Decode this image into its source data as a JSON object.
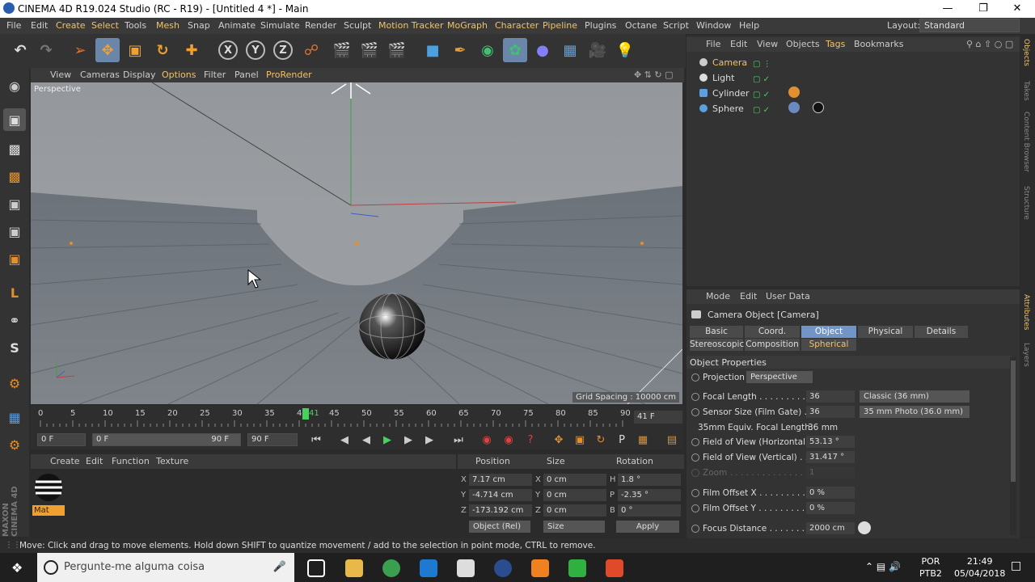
{
  "window": {
    "title": "CINEMA 4D R19.024 Studio (RC - R19) - [Untitled 4 *] - Main"
  },
  "menu": {
    "items": [
      "File",
      "Edit",
      "Create",
      "Select",
      "Tools",
      "Mesh",
      "Snap",
      "Animate",
      "Simulate",
      "Render",
      "Sculpt",
      "Motion Tracker",
      "MoGraph",
      "Character",
      "Pipeline",
      "Plugins",
      "Octane",
      "Script",
      "Window",
      "Help"
    ],
    "layout_label": "Layout:",
    "layout_value": "Standard"
  },
  "toolbar": {
    "axis_x": "X",
    "axis_y": "Y",
    "axis_z": "Z"
  },
  "viewport": {
    "menu": [
      "View",
      "Cameras",
      "Display",
      "Options",
      "Filter",
      "Panel",
      "ProRender"
    ],
    "label": "Perspective",
    "grid_spacing": "Grid Spacing : 10000 cm"
  },
  "timeline": {
    "ticks": [
      "0",
      "5",
      "10",
      "15",
      "20",
      "25",
      "30",
      "35",
      "40",
      "45",
      "50",
      "55",
      "60",
      "65",
      "70",
      "75",
      "80",
      "85",
      "90"
    ],
    "current_frame_marker": "41",
    "frame_readout": "41 F"
  },
  "transport": {
    "start": "0 F",
    "slider_start": "0 F",
    "slider_end": "90 F",
    "end": "90 F"
  },
  "material_manager": {
    "menu": [
      "Create",
      "Edit",
      "Function",
      "Texture"
    ],
    "material_name": "Mat"
  },
  "coord_manager": {
    "headers": [
      "Position",
      "Size",
      "Rotation"
    ],
    "pos": {
      "x": "7.17 cm",
      "y": "-4.714 cm",
      "z": "-173.192 cm"
    },
    "size": {
      "x": "0 cm",
      "y": "0 cm",
      "z": "0 cm"
    },
    "rot": {
      "h": "1.8 °",
      "p": "-2.35 °",
      "b": "0 °"
    },
    "axis_labels": {
      "x": "X",
      "y": "Y",
      "z": "Z",
      "h": "H",
      "p": "P",
      "b": "B"
    },
    "mode": "Object (Rel)",
    "size_mode": "Size",
    "apply": "Apply"
  },
  "object_manager": {
    "menu": [
      "File",
      "Edit",
      "View",
      "Objects",
      "Tags",
      "Bookmarks"
    ],
    "objects": [
      {
        "name": "Camera",
        "color": "#f0c36a"
      },
      {
        "name": "Light",
        "color": "#dddddd"
      },
      {
        "name": "Cylinder",
        "color": "#dddddd"
      },
      {
        "name": "Sphere",
        "color": "#dddddd"
      }
    ]
  },
  "attribute_manager": {
    "menu": [
      "Mode",
      "Edit",
      "User Data"
    ],
    "title": "Camera Object [Camera]",
    "tabs_row1": [
      "Basic",
      "Coord.",
      "Object",
      "Physical",
      "Details"
    ],
    "tabs_row2": [
      "Stereoscopic",
      "Composition",
      "Spherical"
    ],
    "selected_tab": "Object",
    "section": "Object Properties",
    "projection_label": "Projection",
    "projection_value": "Perspective",
    "focal_length_label": "Focal Length . . . . . . . . . .",
    "focal_length": "36",
    "focal_preset": "Classic (36 mm)",
    "sensor_label": "Sensor Size (Film Gate) . .",
    "sensor": "36",
    "sensor_preset": "35 mm Photo (36.0 mm)",
    "equiv_label": "35mm Equiv. Focal Length:",
    "equiv_value": "36 mm",
    "fov_h_label": "Field of View (Horizontal)",
    "fov_h": "53.13 °",
    "fov_v_label": "Field of View (Vertical) . .",
    "fov_v": "31.417 °",
    "zoom_label": "Zoom . . . . . . . . . . . . . .",
    "zoom": "1",
    "film_x_label": "Film Offset X . . . . . . . . . .",
    "film_x": "0 %",
    "film_y_label": "Film Offset Y . . . . . . . . . .",
    "film_y": "0 %",
    "focus_label": "Focus Distance . . . . . . . .",
    "focus": "2000 cm"
  },
  "right_tabs": [
    "Objects",
    "Takes",
    "Content Browser",
    "Structure",
    "Attributes",
    "Layers"
  ],
  "status": "Move: Click and drag to move elements. Hold down SHIFT to quantize movement / add to the selection in point mode, CTRL to remove.",
  "taskbar": {
    "search_placeholder": "Pergunte-me alguma coisa",
    "lang_top": "POR",
    "lang_bottom": "PTB2",
    "time": "21:49",
    "date": "05/04/2018"
  }
}
